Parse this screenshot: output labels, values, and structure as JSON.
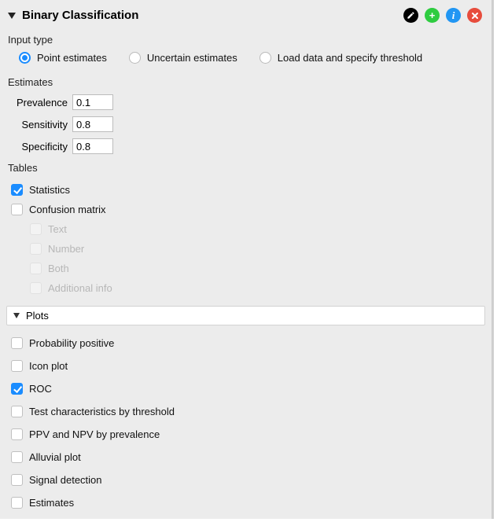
{
  "header": {
    "title": "Binary Classification"
  },
  "inputType": {
    "label": "Input type",
    "options": [
      {
        "label": "Point estimates",
        "selected": true
      },
      {
        "label": "Uncertain estimates",
        "selected": false
      },
      {
        "label": "Load data and specify threshold",
        "selected": false
      }
    ]
  },
  "estimates": {
    "label": "Estimates",
    "fields": [
      {
        "key": "prevalence",
        "label": "Prevalence",
        "value": "0.1"
      },
      {
        "key": "sensitivity",
        "label": "Sensitivity",
        "value": "0.8"
      },
      {
        "key": "specificity",
        "label": "Specificity",
        "value": "0.8"
      }
    ]
  },
  "tables": {
    "label": "Tables",
    "items": [
      {
        "label": "Statistics",
        "checked": true,
        "disabled": false,
        "indent": 0
      },
      {
        "label": "Confusion matrix",
        "checked": false,
        "disabled": false,
        "indent": 0
      },
      {
        "label": "Text",
        "checked": false,
        "disabled": true,
        "indent": 1
      },
      {
        "label": "Number",
        "checked": false,
        "disabled": true,
        "indent": 1
      },
      {
        "label": "Both",
        "checked": false,
        "disabled": true,
        "indent": 1
      },
      {
        "label": "Additional info",
        "checked": false,
        "disabled": true,
        "indent": 1
      }
    ]
  },
  "plots": {
    "header": "Plots",
    "items": [
      {
        "label": "Probability positive",
        "checked": false
      },
      {
        "label": "Icon plot",
        "checked": false
      },
      {
        "label": "ROC",
        "checked": true
      },
      {
        "label": "Test characteristics by threshold",
        "checked": false
      },
      {
        "label": "PPV and NPV by prevalence",
        "checked": false
      },
      {
        "label": "Alluvial plot",
        "checked": false
      },
      {
        "label": "Signal detection",
        "checked": false
      },
      {
        "label": "Estimates",
        "checked": false
      }
    ]
  }
}
